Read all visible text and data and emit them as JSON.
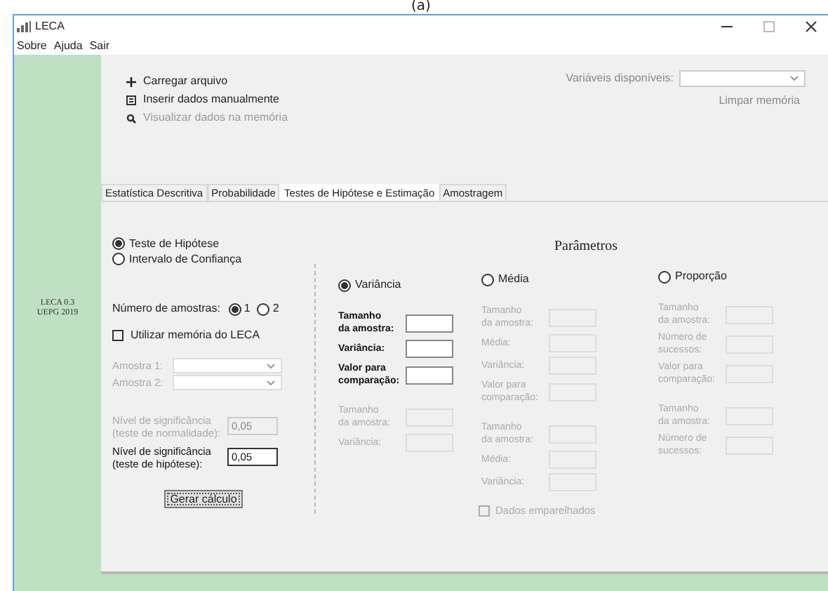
{
  "caption": "(a)",
  "window": {
    "title": "LECA"
  },
  "menu": [
    "Sobre",
    "Ajuda",
    "Sair"
  ],
  "sidebar": {
    "lines": [
      "LECA 0.3",
      "UEPG 2019"
    ]
  },
  "actions": [
    {
      "kind": "load",
      "label": "Carregar arquivo",
      "disabled": false
    },
    {
      "kind": "insert",
      "label": "Inserir dados manualmente",
      "disabled": false
    },
    {
      "kind": "view",
      "label": "Visualizar dados na memória",
      "disabled": true
    }
  ],
  "variables": {
    "label": "Variáveis disponíveis:"
  },
  "clear_memory": "Limpar memória",
  "tabs": [
    {
      "label": "Estatística Descritiva",
      "selected": false
    },
    {
      "label": "Probabilidade",
      "selected": false
    },
    {
      "label": "Testes de Hipótese e Estimação",
      "selected": true
    },
    {
      "label": "Amostragem",
      "selected": false
    }
  ],
  "mode": [
    {
      "label": "Teste de Hipótese",
      "selected": true
    },
    {
      "label": "Intervalo de Confiança",
      "selected": false
    }
  ],
  "samples": {
    "label": "Número de amostras:",
    "options": [
      {
        "label": "1",
        "selected": true
      },
      {
        "label": "2",
        "selected": false
      }
    ]
  },
  "use_memory": {
    "label": "Utilizar memória do LECA",
    "checked": false
  },
  "sample_selects": [
    {
      "label": "Amostra 1:",
      "disabled": true
    },
    {
      "label": "Amostra 2:",
      "disabled": true
    }
  ],
  "significance": [
    {
      "label": "Nível de significância\n(teste de normalidade):",
      "value": "0,05",
      "disabled": true
    },
    {
      "label": "Nível de significância\n(teste de hipótese):",
      "value": "0,05",
      "disabled": false
    }
  ],
  "calculate_button": "Gerar cálculo",
  "parameters": {
    "title": "Parâmetros",
    "groups": [
      {
        "label": "Variância",
        "selected": true,
        "sections": [
          {
            "disabled": false,
            "fields": [
              "Tamanho\nda amostra:",
              "Variância:",
              "Valor para\ncomparação:"
            ]
          },
          {
            "disabled": true,
            "fields": [
              "Tamanho\nda amostra:",
              "Variância:"
            ]
          }
        ]
      },
      {
        "label": "Média",
        "selected": false,
        "sections": [
          {
            "disabled": true,
            "fields": [
              "Tamanho\nda amostra:",
              "Média:",
              "Variância:",
              "Valor para\ncomparação:"
            ]
          },
          {
            "disabled": true,
            "fields": [
              "Tamanho\nda amostra:",
              "Média:",
              "Variância:"
            ]
          }
        ]
      },
      {
        "label": "Proporção",
        "selected": false,
        "sections": [
          {
            "disabled": true,
            "fields": [
              "Tamanho\nda amostra:",
              "Número de\nsucessos:",
              "Valor para\ncomparação:"
            ]
          },
          {
            "disabled": true,
            "fields": [
              "Tamanho\nda amostra:",
              "Número de\nsucessos:"
            ]
          }
        ]
      }
    ]
  },
  "paired": {
    "label": "Dados emparelhados",
    "checked": false,
    "disabled": true
  }
}
